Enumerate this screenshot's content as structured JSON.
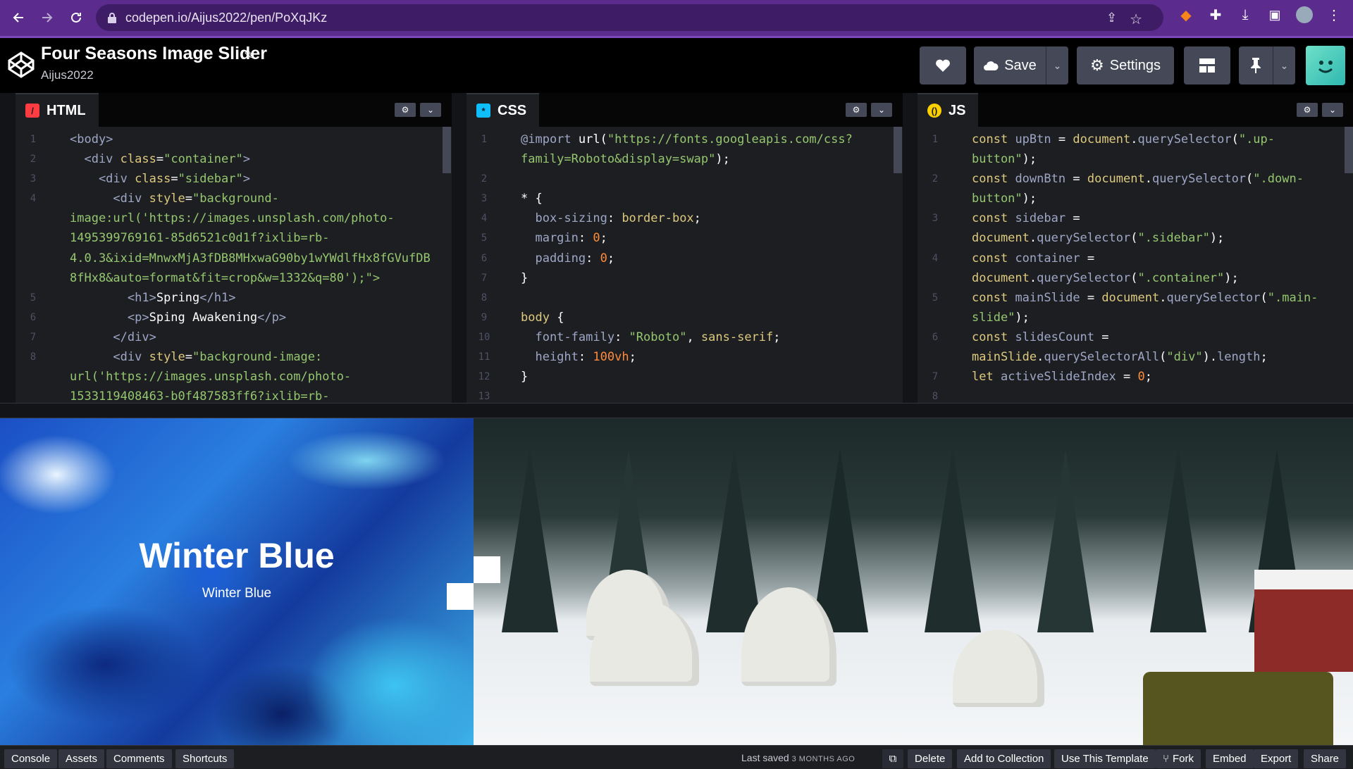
{
  "browser": {
    "url": "codepen.io/Aijus2022/pen/PoXqJKz"
  },
  "header": {
    "title": "Four Seasons Image Slider",
    "author": "Aijus2022",
    "save_label": "Save",
    "settings_label": "Settings"
  },
  "editors": {
    "html": {
      "label": "HTML",
      "lines": [
        {
          "n": "1",
          "t": "<body>"
        },
        {
          "n": "2",
          "t": "  <div class=\"container\">"
        },
        {
          "n": "3",
          "t": "    <div class=\"sidebar\">"
        },
        {
          "n": "4",
          "t": "      <div style=\"background-"
        },
        {
          "n": "",
          "t": "image:url('https://images.unsplash.com/photo-"
        },
        {
          "n": "",
          "t": "1495399769161-85d6521c0d1f?ixlib=rb-"
        },
        {
          "n": "",
          "t": "4.0.3&ixid=MnwxMjA3fDB8MHxwaG90by1wYWdlfHx8fGVufDB"
        },
        {
          "n": "",
          "t": "8fHx8&auto=format&fit=crop&w=1332&q=80');\">"
        },
        {
          "n": "5",
          "t": "        <h1>Spring</h1>"
        },
        {
          "n": "6",
          "t": "        <p>Sping Awakening</p>"
        },
        {
          "n": "7",
          "t": "      </div>"
        },
        {
          "n": "8",
          "t": "      <div style=\"background-image:"
        },
        {
          "n": "",
          "t": "url('https://images.unsplash.com/photo-"
        },
        {
          "n": "",
          "t": "1533119408463-b0f487583ff6?ixlib=rb-"
        }
      ]
    },
    "css": {
      "label": "CSS",
      "lines": [
        {
          "n": "1",
          "t": "@import url(\"https://fonts.googleapis.com/css?"
        },
        {
          "n": "",
          "t": "family=Roboto&display=swap\");"
        },
        {
          "n": "2",
          "t": ""
        },
        {
          "n": "3",
          "t": "* {"
        },
        {
          "n": "4",
          "t": "  box-sizing: border-box;"
        },
        {
          "n": "5",
          "t": "  margin: 0;"
        },
        {
          "n": "6",
          "t": "  padding: 0;"
        },
        {
          "n": "7",
          "t": "}"
        },
        {
          "n": "8",
          "t": ""
        },
        {
          "n": "9",
          "t": "body {"
        },
        {
          "n": "10",
          "t": "  font-family: \"Roboto\", sans-serif;"
        },
        {
          "n": "11",
          "t": "  height: 100vh;"
        },
        {
          "n": "12",
          "t": "}"
        },
        {
          "n": "13",
          "t": ""
        }
      ]
    },
    "js": {
      "label": "JS",
      "lines": [
        {
          "n": "1",
          "t": "const upBtn = document.querySelector(\".up-"
        },
        {
          "n": "",
          "t": "button\");"
        },
        {
          "n": "2",
          "t": "const downBtn = document.querySelector(\".down-"
        },
        {
          "n": "",
          "t": "button\");"
        },
        {
          "n": "3",
          "t": "const sidebar ="
        },
        {
          "n": "",
          "t": "document.querySelector(\".sidebar\");"
        },
        {
          "n": "4",
          "t": "const container ="
        },
        {
          "n": "",
          "t": "document.querySelector(\".container\");"
        },
        {
          "n": "5",
          "t": "const mainSlide = document.querySelector(\".main-"
        },
        {
          "n": "",
          "t": "slide\");"
        },
        {
          "n": "6",
          "t": "const slidesCount ="
        },
        {
          "n": "",
          "t": "mainSlide.querySelectorAll(\"div\").length;"
        },
        {
          "n": "7",
          "t": "let activeSlideIndex = 0;"
        },
        {
          "n": "8",
          "t": ""
        }
      ]
    }
  },
  "preview": {
    "slide_title": "Winter Blue",
    "slide_subtitle": "Winter Blue"
  },
  "footer": {
    "console": "Console",
    "assets": "Assets",
    "comments": "Comments",
    "shortcuts": "Shortcuts",
    "saved_prefix": "Last saved",
    "saved_when": "3 MONTHS AGO",
    "delete": "Delete",
    "add_to_collection": "Add to Collection",
    "use_template": "Use This Template",
    "fork": "Fork",
    "embed": "Embed",
    "export": "Export",
    "share": "Share"
  },
  "colors": {
    "browser_bar": "#5b2c8e",
    "editor_bg": "#1d1e22",
    "button_bg": "#444857",
    "html_icon": "#ff3c41",
    "css_icon": "#0ebeff",
    "js_icon": "#fcd000"
  }
}
